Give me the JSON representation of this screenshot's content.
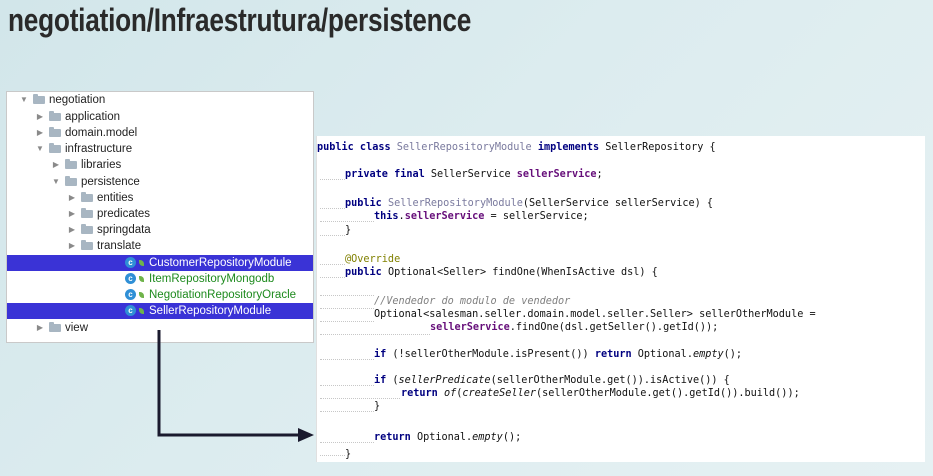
{
  "title": "negotiation/Infraestrutura/persistence",
  "tree": [
    {
      "label": "negotiation",
      "type": "folder",
      "depth": 0,
      "expanded": true
    },
    {
      "label": "application",
      "type": "folder",
      "depth": 1,
      "expanded": false
    },
    {
      "label": "domain.model",
      "type": "folder",
      "depth": 1,
      "expanded": false
    },
    {
      "label": "infrastructure",
      "type": "folder",
      "depth": 1,
      "expanded": true
    },
    {
      "label": "libraries",
      "type": "folder",
      "depth": 2,
      "expanded": false
    },
    {
      "label": "persistence",
      "type": "folder",
      "depth": 2,
      "expanded": true
    },
    {
      "label": "entities",
      "type": "folder",
      "depth": 3,
      "expanded": false
    },
    {
      "label": "predicates",
      "type": "folder",
      "depth": 3,
      "expanded": false
    },
    {
      "label": "springdata",
      "type": "folder",
      "depth": 3,
      "expanded": false
    },
    {
      "label": "translate",
      "type": "folder",
      "depth": 3,
      "expanded": false
    },
    {
      "label": "CustomerRepositoryModule",
      "type": "class",
      "depth": 4,
      "selected": true
    },
    {
      "label": "ItemRepositoryMongodb",
      "type": "class",
      "depth": 4,
      "selected": false
    },
    {
      "label": "NegotiationRepositoryOracle",
      "type": "class",
      "depth": 4,
      "selected": false
    },
    {
      "label": "SellerRepositoryModule",
      "type": "class",
      "depth": 4,
      "selected": true
    },
    {
      "label": "view",
      "type": "folder",
      "depth": 1,
      "expanded": false
    }
  ],
  "code": {
    "l1": {
      "a": "public class ",
      "b": "SellerRepositoryModule ",
      "c": "implements ",
      "d": "SellerRepository {"
    },
    "l2": {
      "a": "private final ",
      "b": "SellerService ",
      "c": "sellerService",
      "d": ";"
    },
    "l3": {
      "a": "public ",
      "b": "SellerRepositoryModule",
      "c": "(SellerService sellerService) {"
    },
    "l4": {
      "a": "this",
      "b": ".",
      "c": "sellerService",
      "d": " = sellerService;"
    },
    "l5": "}",
    "l6": "@Override",
    "l7": {
      "a": "public ",
      "b": "Optional<Seller> findOne(WhenIsActive dsl) {"
    },
    "l8": "//Vendedor do modulo de vendedor",
    "l9": "Optional<salesman.seller.domain.model.seller.Seller> sellerOtherModule =",
    "l10": {
      "a": "sellerService",
      "b": ".findOne(dsl.getSeller().getId());"
    },
    "l11": {
      "a": "if ",
      "b": "(!sellerOtherModule.isPresent()) ",
      "c": "return ",
      "d": "Optional.",
      "e": "empty",
      "f": "();"
    },
    "l12": {
      "a": "if ",
      "b": "(",
      "c": "sellerPredicate",
      "d": "(sellerOtherModule.get()).isActive()) {"
    },
    "l13": {
      "a": "return ",
      "b": "of",
      "c": "(",
      "d": "createSeller",
      "e": "(sellerOtherModule.get().getId()).build());"
    },
    "l14": "}",
    "l15": {
      "a": "return ",
      "b": "Optional.",
      "c": "empty",
      "d": "();"
    },
    "l16": "}"
  },
  "colors": {
    "selection": "#3a33d6",
    "keyword": "#000080",
    "field": "#660e7a",
    "annotation": "#808000",
    "arrow": "#1a1a2e"
  }
}
